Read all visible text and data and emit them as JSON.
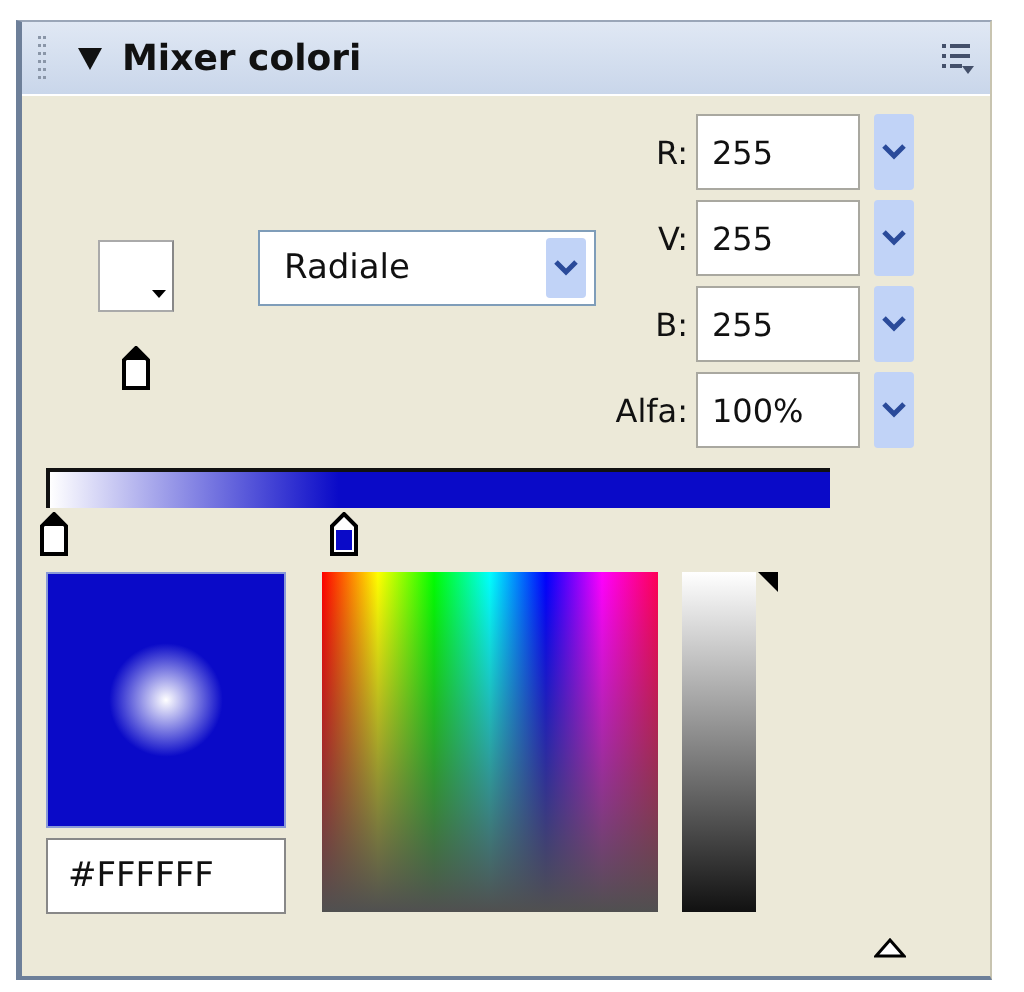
{
  "panel": {
    "title": "Mixer colori",
    "expanded": true
  },
  "fill_type": {
    "value": "Radiale"
  },
  "channels": [
    {
      "label": "R:",
      "value": "255"
    },
    {
      "label": "V:",
      "value": "255"
    },
    {
      "label": "B:",
      "value": "255"
    },
    {
      "label": "Alfa:",
      "value": "100%"
    }
  ],
  "gradient_stops": [
    {
      "color": "#ffffff",
      "selected": true
    },
    {
      "color": "#0a0ac8",
      "selected": false
    }
  ],
  "hex": {
    "value": "#FFFFFF"
  },
  "brightness": {
    "level": 1
  }
}
